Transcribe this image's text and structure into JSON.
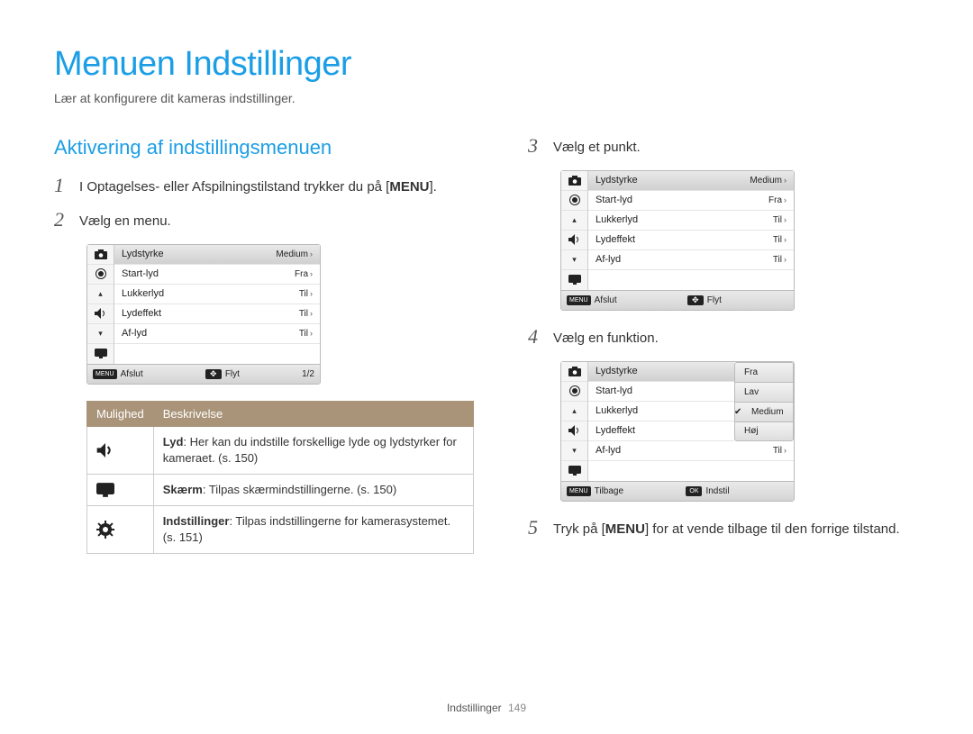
{
  "title": "Menuen Indstillinger",
  "subtitle": "Lær at konfigurere dit kameras indstillinger.",
  "section_title": "Aktivering af indstillingsmenuen",
  "steps": {
    "s1": {
      "num": "1",
      "pre": "I Optagelses- eller Afspilningstilstand trykker du på [",
      "menu": "MENU",
      "post": "]."
    },
    "s2": {
      "num": "2",
      "text": "Vælg en menu."
    },
    "s3": {
      "num": "3",
      "text": "Vælg et punkt."
    },
    "s4": {
      "num": "4",
      "text": "Vælg en funktion."
    },
    "s5": {
      "num": "5",
      "pre": "Tryk på [",
      "menu": "MENU",
      "post": "] for at vende tilbage til den forrige tilstand."
    }
  },
  "widget_rows": [
    {
      "label": "Lydstyrke",
      "value": "Medium"
    },
    {
      "label": "Start-lyd",
      "value": "Fra"
    },
    {
      "label": "Lukkerlyd",
      "value": "Til"
    },
    {
      "label": "Lydeffekt",
      "value": "Til"
    },
    {
      "label": "Af-lyd",
      "value": "Til"
    }
  ],
  "widget2_footer": {
    "left_icon": "MENU",
    "left_label": "Afslut",
    "mid_icon": "✥",
    "mid_label": "Flyt",
    "right": "1/2"
  },
  "widget3_footer": {
    "left_icon": "MENU",
    "left_label": "Afslut",
    "mid_icon": "✥",
    "mid_label": "Flyt"
  },
  "widget4": {
    "left_labels": [
      "Lydstyrke",
      "Start-lyd",
      "Lukkerlyd",
      "Lydeffekt"
    ],
    "options": [
      "Fra",
      "Lav",
      "Medium",
      "Høj"
    ],
    "selected_index": 2,
    "bottom_row": {
      "label": "Af-lyd",
      "value": "Til"
    },
    "footer": {
      "left_icon": "MENU",
      "left_label": "Tilbage",
      "mid_icon": "OK",
      "mid_label": "Indstil"
    }
  },
  "desc_table": {
    "head": {
      "c1": "Mulighed",
      "c2": "Beskrivelse"
    },
    "rows": [
      {
        "b": "Lyd",
        "rest": ": Her kan du indstille forskellige lyde og lydstyrker for kameraet. (s. 150)"
      },
      {
        "b": "Skærm",
        "rest": ": Tilpas skærmindstillingerne. (s. 150)"
      },
      {
        "b": "Indstillinger",
        "rest": ": Tilpas indstillingerne for kamerasystemet. (s. 151)"
      }
    ]
  },
  "footer": {
    "label": "Indstillinger",
    "page": "149"
  },
  "icons": {
    "camera": "camera-icon",
    "record": "record-icon",
    "speaker": "speaker-icon",
    "monitor": "monitor-icon",
    "gear": "gear-icon",
    "chev_up": "▴",
    "chev_down": "▾"
  }
}
